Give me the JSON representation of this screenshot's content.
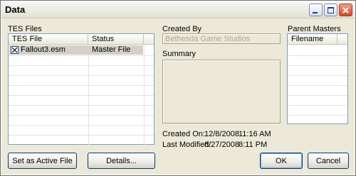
{
  "window": {
    "title": "Data"
  },
  "tes_files": {
    "label": "TES Files",
    "columns": [
      "TES File",
      "Status"
    ],
    "rows": [
      {
        "file": "Fallout3.esm",
        "status": "Master File",
        "checked": true,
        "selected": true
      }
    ]
  },
  "created_by": {
    "label": "Created By",
    "value": "Bethesda Game Studios"
  },
  "summary": {
    "label": "Summary",
    "value": ""
  },
  "created_on": {
    "label": "Created On:",
    "date": "12/8/2008",
    "time": "11:16 AM"
  },
  "last_modified": {
    "label": "Last Modified:",
    "date": "8/27/2008",
    "time": "8:11 PM"
  },
  "parent_masters": {
    "label": "Parent Masters",
    "columns": [
      "Filename"
    ]
  },
  "buttons": {
    "set_active": "Set as Active File",
    "details": "Details...",
    "ok": "OK",
    "cancel": "Cancel"
  },
  "icons": {
    "minimize": "minimize-icon",
    "maximize": "maximize-icon",
    "close": "close-icon",
    "checkbox": "checkbox-checked-icon"
  }
}
